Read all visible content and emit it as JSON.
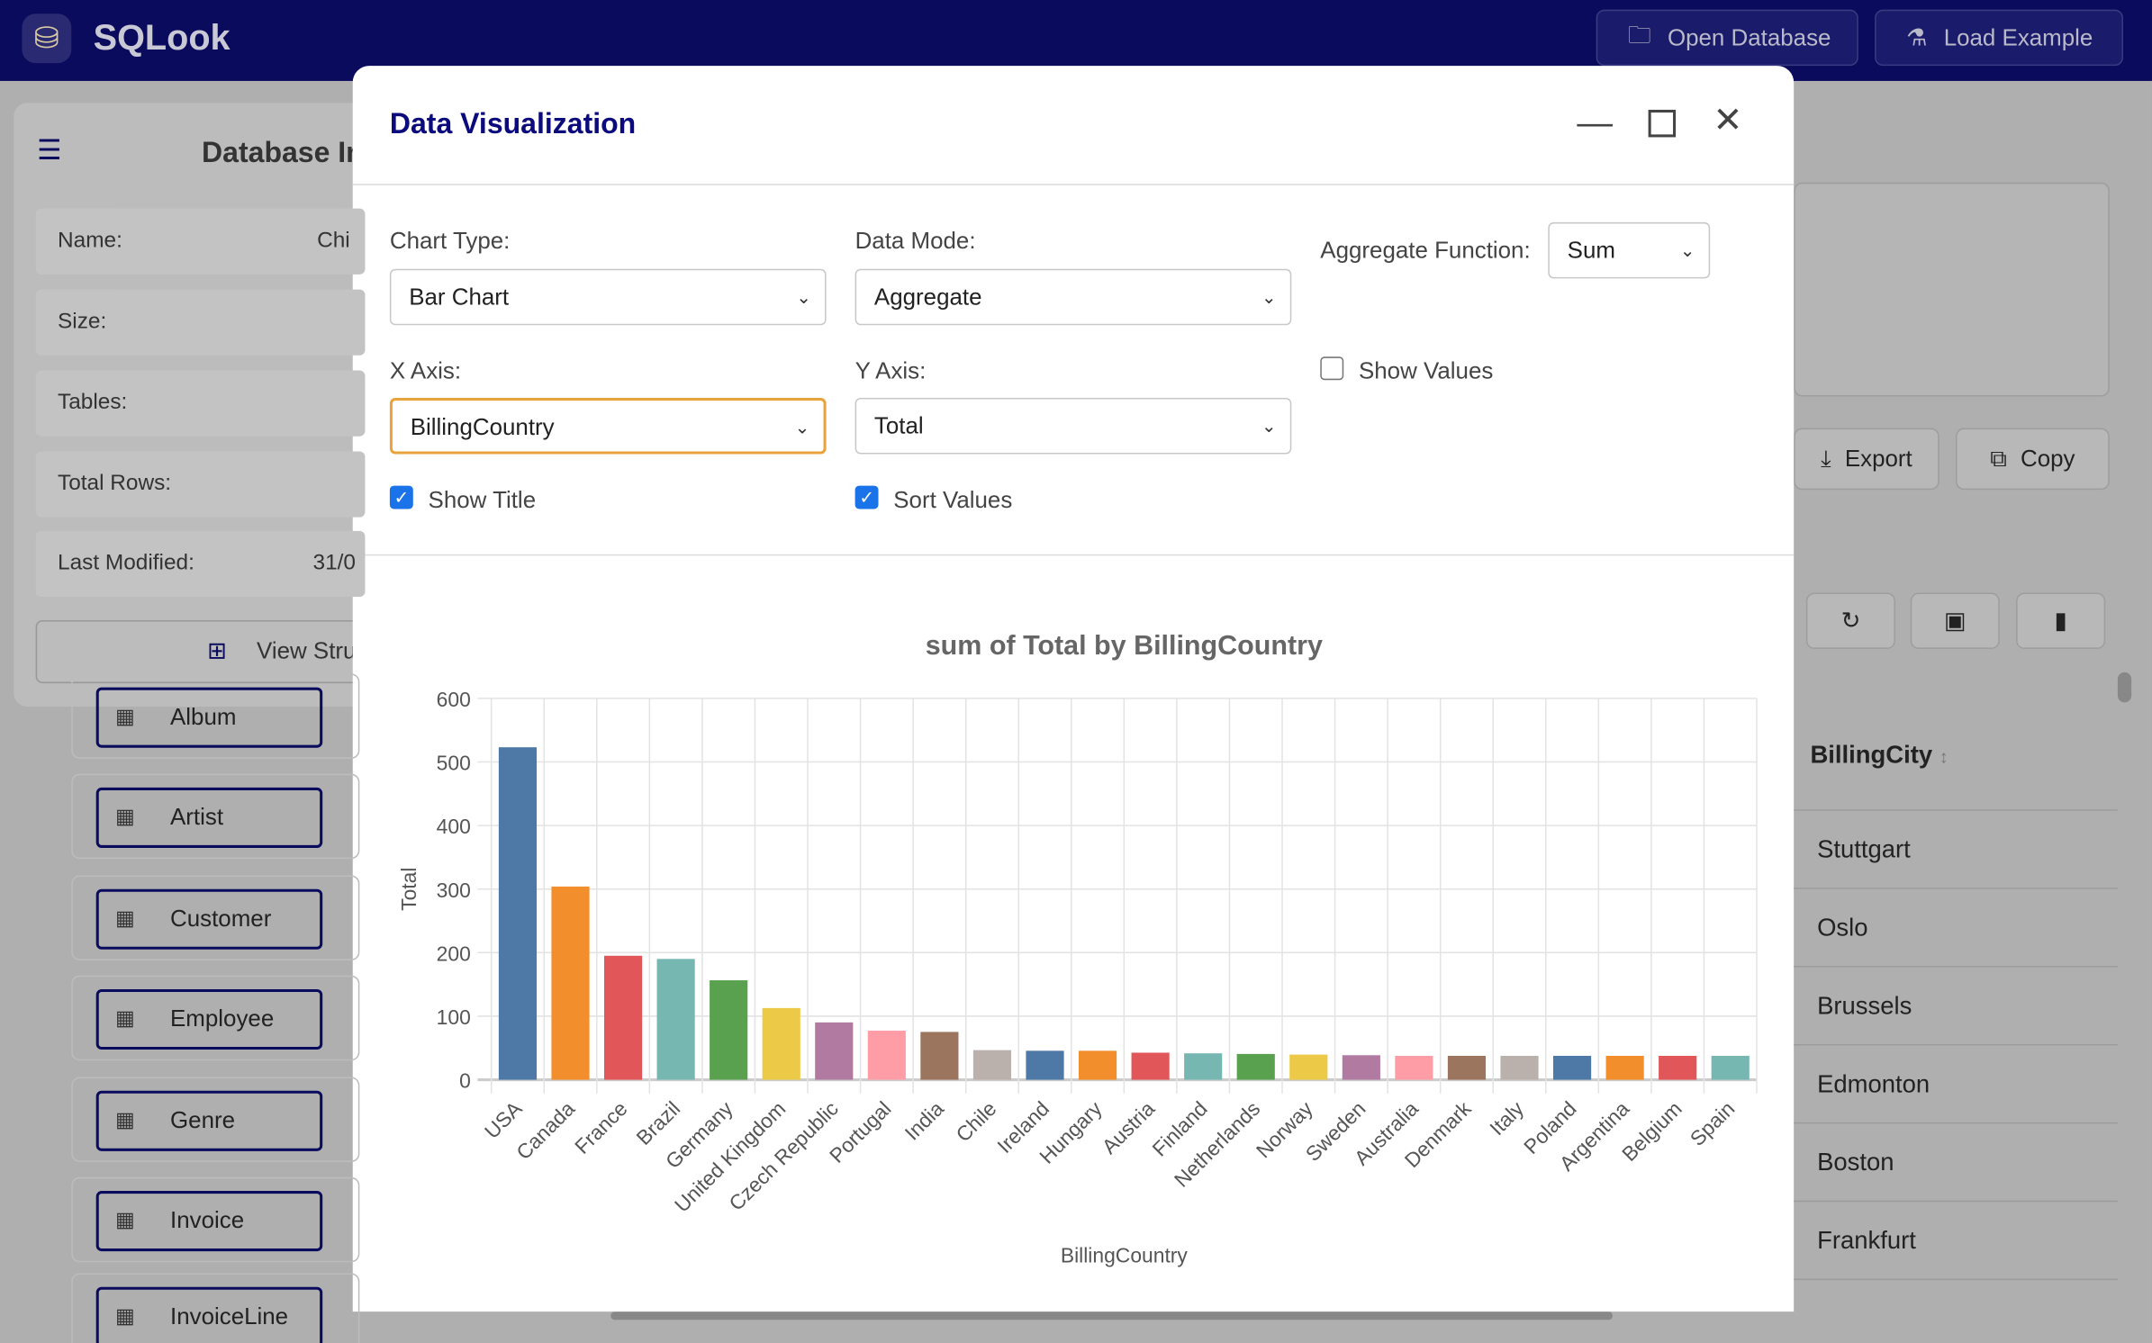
{
  "app": {
    "title": "SQLook",
    "open_database": "Open Database",
    "load_example": "Load Example"
  },
  "left_panel": {
    "title": "Database In",
    "rows": [
      {
        "label": "Name:",
        "value": "Chi"
      },
      {
        "label": "Size:",
        "value": ""
      },
      {
        "label": "Tables:",
        "value": ""
      },
      {
        "label": "Total Rows:",
        "value": ""
      },
      {
        "label": "Last Modified:",
        "value": "31/0"
      }
    ],
    "view_structure": "View Stru"
  },
  "tables": [
    "Album",
    "Artist",
    "Customer",
    "Employee",
    "Genre",
    "Invoice",
    "InvoiceLine"
  ],
  "right_panel": {
    "export": "Export",
    "copy": "Copy",
    "column_header": "BillingCity",
    "cities": [
      "Stuttgart",
      "Oslo",
      "Brussels",
      "Edmonton",
      "Boston",
      "Frankfurt"
    ]
  },
  "modal": {
    "title": "Data Visualization",
    "chart_type_label": "Chart Type:",
    "chart_type": "Bar Chart",
    "data_mode_label": "Data Mode:",
    "data_mode": "Aggregate",
    "aggregate_label": "Aggregate Function:",
    "aggregate": "Sum",
    "x_axis_label": "X Axis:",
    "x_axis": "BillingCountry",
    "y_axis_label": "Y Axis:",
    "y_axis": "Total",
    "show_values_label": "Show Values",
    "show_values": false,
    "show_title_label": "Show Title",
    "show_title": true,
    "sort_values_label": "Sort Values",
    "sort_values": true
  },
  "chart_data": {
    "type": "bar",
    "title": "sum of Total by BillingCountry",
    "xlabel": "BillingCountry",
    "ylabel": "Total",
    "ylim": [
      0,
      600
    ],
    "yticks": [
      0,
      100,
      200,
      300,
      400,
      500,
      600
    ],
    "grid": true,
    "categories": [
      "USA",
      "Canada",
      "France",
      "Brazil",
      "Germany",
      "United Kingdom",
      "Czech Republic",
      "Portugal",
      "India",
      "Chile",
      "Ireland",
      "Hungary",
      "Austria",
      "Finland",
      "Netherlands",
      "Norway",
      "Sweden",
      "Australia",
      "Denmark",
      "Italy",
      "Poland",
      "Argentina",
      "Belgium",
      "Spain"
    ],
    "values": [
      523.06,
      303.96,
      195.1,
      190.1,
      156.48,
      112.86,
      90.24,
      77.24,
      75.26,
      46.62,
      45.62,
      45.62,
      42.62,
      41.62,
      40.62,
      39.62,
      38.62,
      37.62,
      37.62,
      37.62,
      37.62,
      37.62,
      37.62,
      37.62
    ],
    "colors": [
      "#4e79a7",
      "#f28e2b",
      "#e15759",
      "#76b7b2",
      "#59a14f",
      "#edc948",
      "#b07aa1",
      "#ff9da7",
      "#9c755f",
      "#bab0ac"
    ]
  }
}
